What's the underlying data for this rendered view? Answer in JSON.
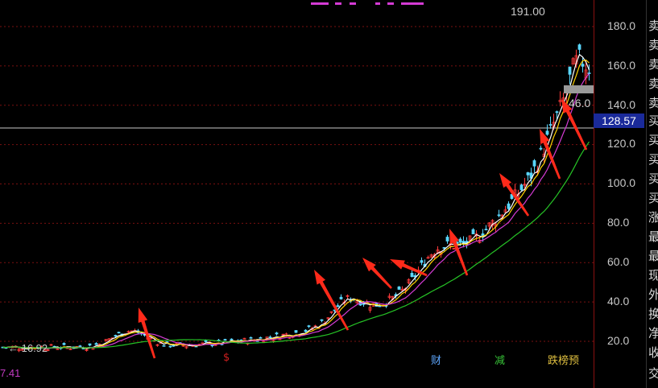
{
  "axis": {
    "ticks": [
      "180.0",
      "160.0",
      "140.0",
      "120.0",
      "100.0",
      "80.0",
      "60.0",
      "40.0",
      "20.0"
    ]
  },
  "price_badge": "128.57",
  "max_label": "191.00",
  "min_label": "← 16.92",
  "low_label": "7.41",
  "side_value": "46.0",
  "markers": [
    {
      "text": "$",
      "color": "#d02020"
    },
    {
      "text": "财",
      "color": "#5fa8ff"
    },
    {
      "text": "减",
      "color": "#37c137"
    },
    {
      "text": "跌榜预",
      "color": "#e0c040"
    }
  ],
  "side_panel": [
    "卖",
    "卖",
    "卖",
    "卖",
    "卖",
    "买",
    "买",
    "买",
    "买",
    "买",
    "涨",
    "最",
    "最",
    "现",
    "外",
    "换",
    "净",
    "收",
    "交"
  ],
  "colors": {
    "up": "#ff3b3b",
    "down": "#5ad7ff",
    "ma5": "#ffffff",
    "ma10": "#ffd400",
    "ma20": "#d43bd4",
    "ma60": "#26c426",
    "arrow": "#ff2a1a"
  }
}
